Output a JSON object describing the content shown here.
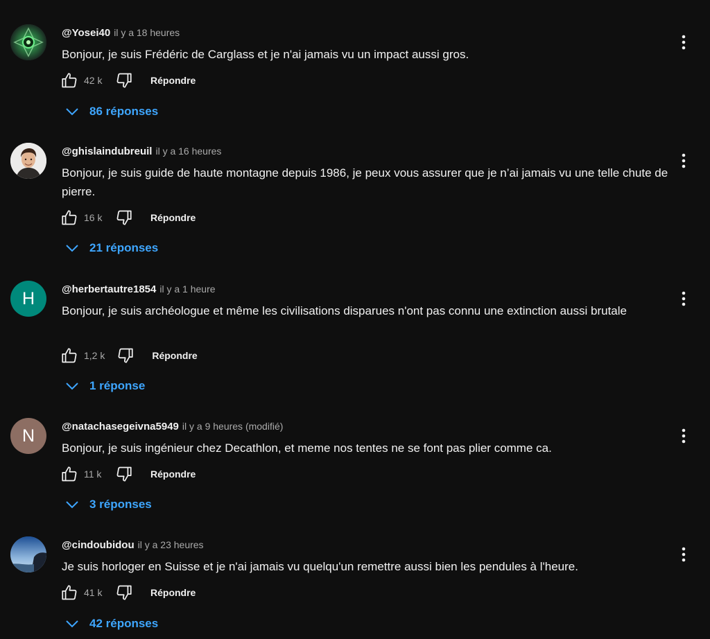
{
  "comments": [
    {
      "author": "@Yosei40",
      "time": "il y a 18 heures",
      "text": "Bonjour, je suis Frédéric de Carglass et je n'ai jamais vu un impact aussi gros.",
      "likes": "42 k",
      "reply_label": "Répondre",
      "replies_label": "86 réponses",
      "avatar_letter": ""
    },
    {
      "author": "@ghislaindubreuil",
      "time": "il y a 16 heures",
      "text": "Bonjour, je suis guide de haute montagne depuis 1986, je peux vous assurer que je n’ai jamais vu une telle chute de pierre.",
      "likes": "16 k",
      "reply_label": "Répondre",
      "replies_label": "21 réponses",
      "avatar_letter": ""
    },
    {
      "author": "@herbertautre1854",
      "time": "il y a 1 heure",
      "text": "Bonjour, je suis archéologue et même les civilisations disparues n'ont pas connu une extinction aussi brutale",
      "likes": "1,2 k",
      "reply_label": "Répondre",
      "replies_label": "1 réponse",
      "avatar_letter": "H"
    },
    {
      "author": "@natachasegeivna5949",
      "time": "il y a 9 heures (modifié)",
      "text": "Bonjour, je suis ingénieur chez Decathlon, et meme nos tentes ne se font pas plier comme ca.",
      "likes": "11 k",
      "reply_label": "Répondre",
      "replies_label": "3 réponses",
      "avatar_letter": "N"
    },
    {
      "author": "@cindoubidou",
      "time": "il y a 23 heures",
      "text": "Je suis horloger en Suisse et je n'ai jamais vu quelqu'un remettre aussi bien les pendules à l'heure.",
      "likes": "41 k",
      "reply_label": "Répondre",
      "replies_label": "42 réponses",
      "avatar_letter": ""
    }
  ],
  "colors": {
    "background": "#0f0f0f",
    "text": "#f1f1f1",
    "muted": "#aaaaaa",
    "link": "#3ea6ff",
    "avatar_h": "#00897b",
    "avatar_n": "#8d6e63"
  },
  "icons": [
    "thumb-up-icon",
    "thumb-down-icon",
    "chevron-down-icon",
    "more-vert-icon"
  ]
}
